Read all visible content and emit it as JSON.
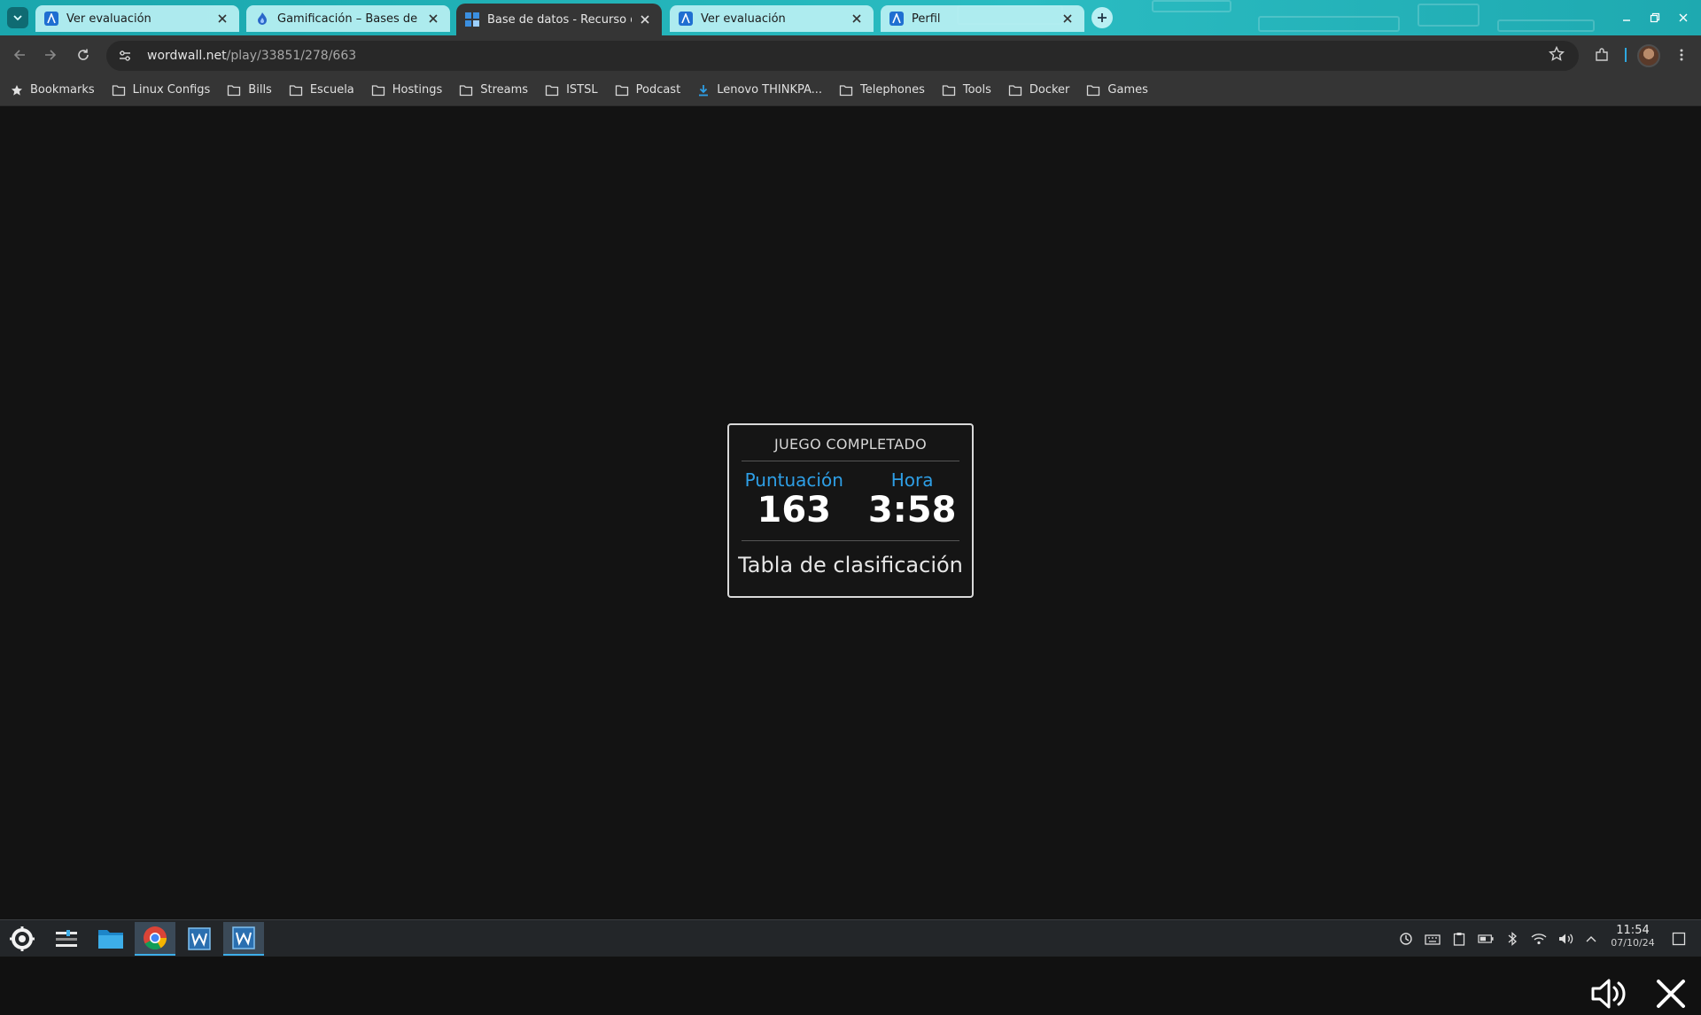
{
  "browser": {
    "tabs": [
      {
        "title": "Ver evaluación",
        "favicon": "azure-a-icon",
        "active": false
      },
      {
        "title": "Gamificación – Bases de da",
        "favicon": "flame-icon",
        "active": false
      },
      {
        "title": "Base de datos - Recurso did",
        "favicon": "wordwall-icon",
        "active": true
      },
      {
        "title": "Ver evaluación",
        "favicon": "azure-a-icon",
        "active": false
      },
      {
        "title": "Perfil",
        "favicon": "azure-a-icon",
        "active": false
      }
    ],
    "address": {
      "domain": "wordwall.net",
      "path": "/play/33851/278/663"
    },
    "bookmarks": [
      {
        "label": "Bookmarks",
        "icon": "star-icon"
      },
      {
        "label": "Linux Configs",
        "icon": "folder-icon"
      },
      {
        "label": "Bills",
        "icon": "folder-icon"
      },
      {
        "label": "Escuela",
        "icon": "folder-icon"
      },
      {
        "label": "Hostings",
        "icon": "folder-icon"
      },
      {
        "label": "Streams",
        "icon": "folder-icon"
      },
      {
        "label": "ISTSL",
        "icon": "folder-icon"
      },
      {
        "label": "Podcast",
        "icon": "folder-icon"
      },
      {
        "label": "Lenovo THINKPA...",
        "icon": "download-icon"
      },
      {
        "label": "Telephones",
        "icon": "folder-icon"
      },
      {
        "label": "Tools",
        "icon": "folder-icon"
      },
      {
        "label": "Docker",
        "icon": "folder-icon"
      },
      {
        "label": "Games",
        "icon": "folder-icon"
      }
    ]
  },
  "game": {
    "heading": "JUEGO COMPLETADO",
    "score_label": "Puntuación",
    "score_value": "163",
    "time_label": "Hora",
    "time_value": "3:58",
    "leaderboard_label": "Tabla de clasificación"
  },
  "taskbar": {
    "clock_time": "11:54",
    "clock_date": "07/10/24"
  },
  "colors": {
    "accent_blue": "#2e9fe6",
    "tabstrip": "#22b3b8",
    "page_bg": "#131313"
  }
}
